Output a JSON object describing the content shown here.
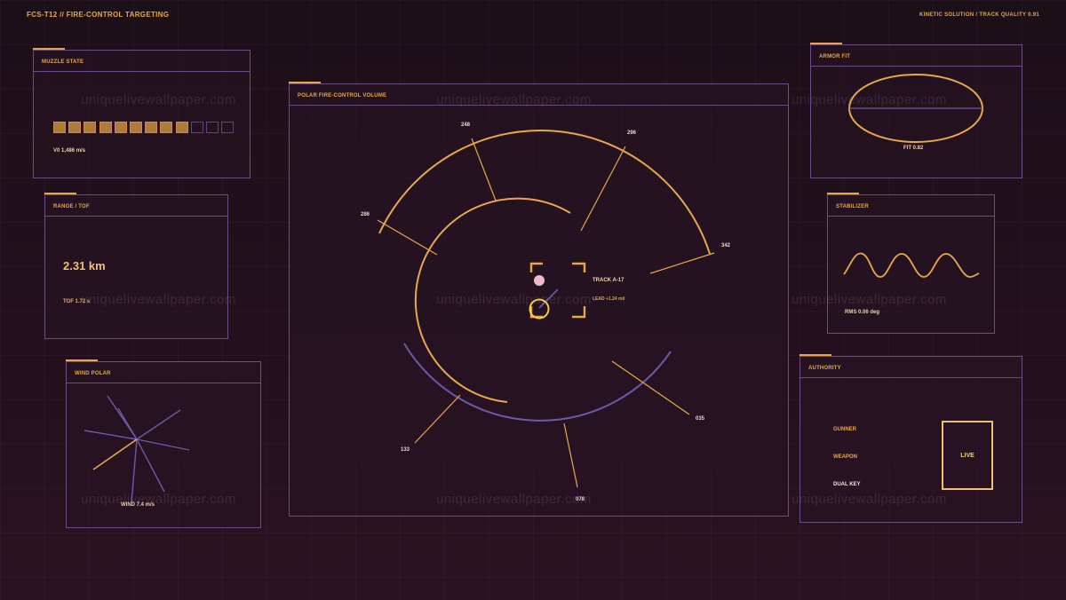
{
  "header": {
    "title": "FCS-T12 // FIRE-CONTROL TARGETING",
    "status": "KINETIC SOLUTION / TRACK QUALITY 0.91"
  },
  "watermark": "uniquelivewallpaper.com",
  "muzzle": {
    "title": "MUZZLE STATE",
    "segments_total": 12,
    "segments_filled": 9,
    "velocity_label": "V0  1,486 m/s"
  },
  "range": {
    "title": "RANGE / TOF",
    "value": "2.31 km",
    "tof": "TOF 1.72 s"
  },
  "wind": {
    "title": "WIND POLAR",
    "label": "WIND 7.4 m/s"
  },
  "polar": {
    "title": "POLAR FIRE-CONTROL VOLUME",
    "bearings": [
      "248",
      "296",
      "342",
      "035",
      "078",
      "133",
      "286"
    ],
    "track_label": "TRACK A-17",
    "lead_label": "LEAD +1.24 mil"
  },
  "armor": {
    "title": "ARMOR FIT",
    "fit": "FIT  0.82"
  },
  "stabilizer": {
    "title": "STABILIZER",
    "rms": "RMS 0.06 deg"
  },
  "authority": {
    "title": "AUTHORITY",
    "items": [
      "GUNNER",
      "WEAPON",
      "DUAL KEY"
    ],
    "state": "LIVE"
  },
  "colors": {
    "accent": "#e8a84a",
    "frame": "#6b4f84",
    "violet": "#6a5aa8",
    "target": "#f2b8c6"
  }
}
